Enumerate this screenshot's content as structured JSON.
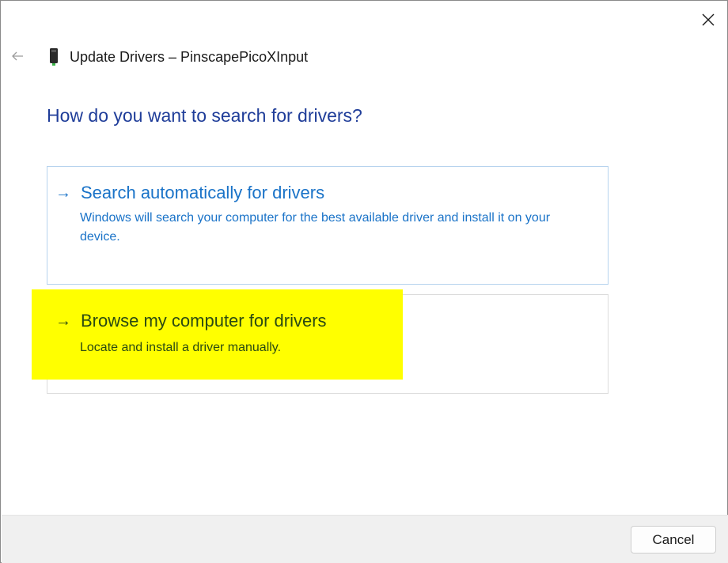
{
  "window": {
    "title": "Update Drivers – PinscapePicoXInput",
    "close_icon": "close-icon",
    "back_icon": "back-arrow-icon",
    "device_icon": "usb-device-icon"
  },
  "main": {
    "heading": "How do you want to search for drivers?",
    "options": [
      {
        "arrow": "→",
        "title": "Search automatically for drivers",
        "description": "Windows will search your computer for the best available driver and install it on your device."
      },
      {
        "arrow": "→",
        "title": "Browse my computer for drivers",
        "description": "Locate and install a driver manually.",
        "highlight_color": "#ffff00"
      }
    ]
  },
  "footer": {
    "cancel_label": "Cancel"
  },
  "colors": {
    "heading": "#1f3d99",
    "link": "#1a73c8",
    "highlight": "#ffff00"
  }
}
